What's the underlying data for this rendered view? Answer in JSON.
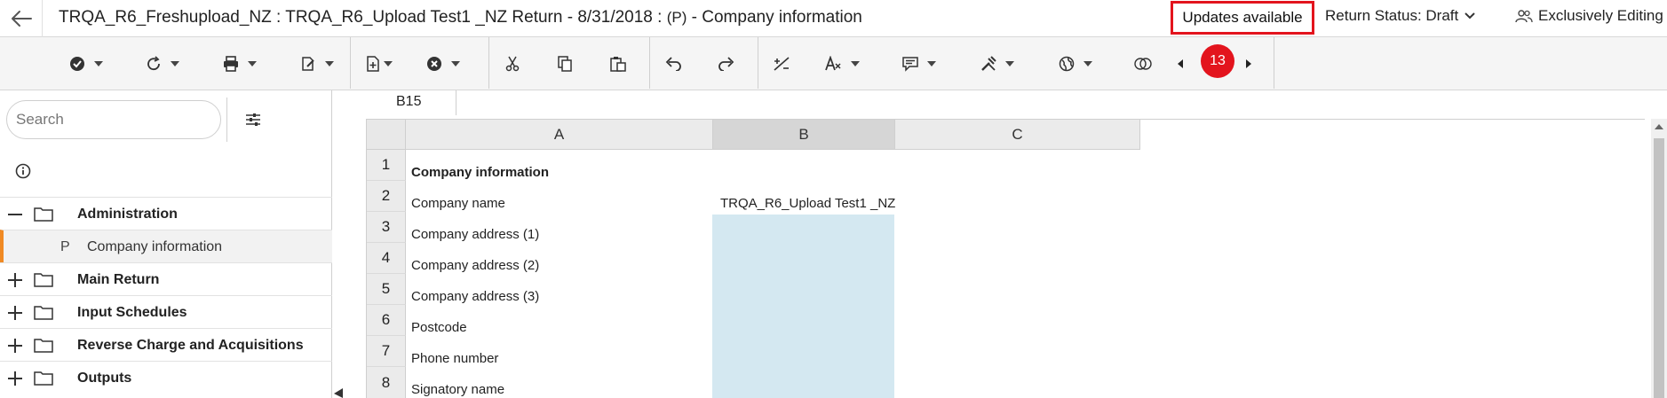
{
  "header": {
    "title_main": "TRQA_R6_Freshupload_NZ : TRQA_R6_Upload Test1 _NZ Return - 8/31/2018 : ",
    "title_tag": "(P)",
    "title_tail": " - Company information",
    "updates_label": "Updates available",
    "return_status_label": "Return Status: Draft",
    "exclusive_label": "Exclusively Editing"
  },
  "toolbar": {
    "notification_count": "13",
    "icons": [
      "check-circle-icon",
      "refresh-icon",
      "print-icon",
      "edit-export-icon",
      "add-form-icon",
      "remove-circle-icon",
      "cut-icon",
      "copy-icon",
      "paste-icon",
      "undo-icon",
      "redo-icon",
      "override-icon",
      "font-style-icon",
      "comment-icon",
      "tools-icon",
      "globe-icon",
      "compare-icon"
    ]
  },
  "sidebar": {
    "search_placeholder": "Search",
    "tree": [
      {
        "label": "Administration",
        "expanded": true
      },
      {
        "prefix": "P",
        "label": "Company information",
        "selected": true
      },
      {
        "label": "Main Return",
        "expanded": false
      },
      {
        "label": "Input Schedules",
        "expanded": false
      },
      {
        "label": "Reverse Charge and Acquisitions",
        "expanded": false
      },
      {
        "label": "Outputs",
        "expanded": false
      }
    ]
  },
  "sheet": {
    "cell_ref": "B15",
    "columns": [
      "A",
      "B",
      "C"
    ],
    "selected_column": "B",
    "rows": [
      {
        "num": "1",
        "label": "Company information",
        "value": ""
      },
      {
        "num": "2",
        "label": "Company name",
        "value": "TRQA_R6_Upload Test1 _NZ"
      },
      {
        "num": "3",
        "label": "Company address (1)",
        "value": ""
      },
      {
        "num": "4",
        "label": "Company address (2)",
        "value": ""
      },
      {
        "num": "5",
        "label": "Company address (3)",
        "value": ""
      },
      {
        "num": "6",
        "label": "Postcode",
        "value": ""
      },
      {
        "num": "7",
        "label": "Phone number",
        "value": ""
      },
      {
        "num": "8",
        "label": "Signatory name",
        "value": ""
      }
    ],
    "input_fill_color": "#d4e8f1"
  },
  "colors": {
    "alert_red": "#e3141d",
    "selection_orange": "#f08a24"
  }
}
